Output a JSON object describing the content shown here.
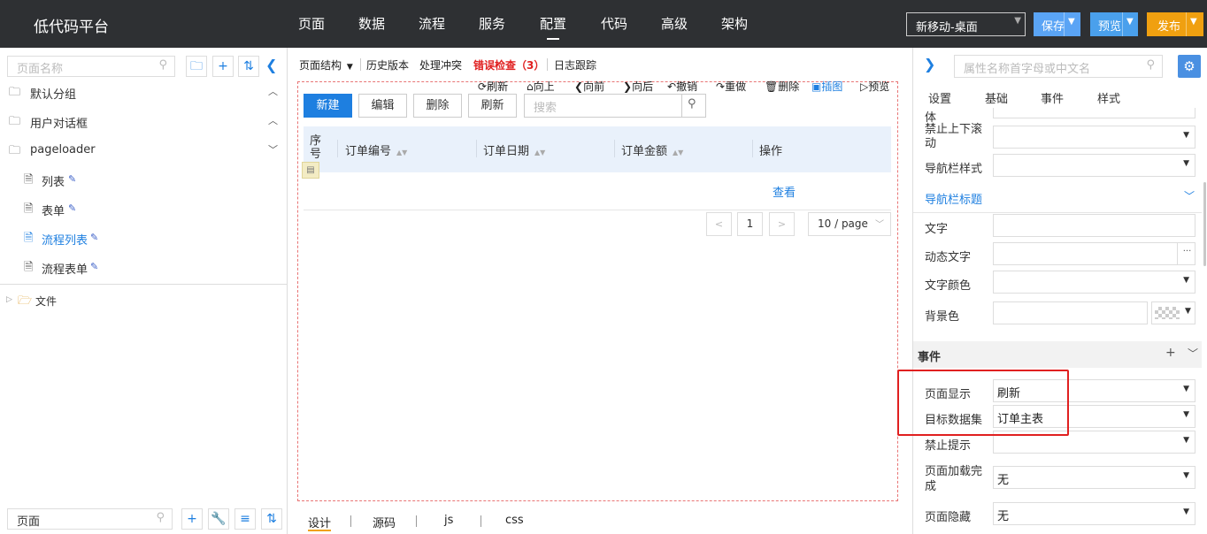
{
  "app": {
    "logo": "低代码平台",
    "nav": [
      "页面",
      "数据",
      "流程",
      "服务",
      "配置",
      "代码",
      "高级",
      "架构"
    ],
    "active_nav": "配置",
    "env_select": "新移动-桌面",
    "save_label": "保存",
    "preview_label": "预览",
    "publish_label": "发布",
    "colors": {
      "topbar": "#2e3033",
      "primary": "#1e7fe0",
      "save": "#5aa4f5",
      "preview": "#4aa0ec",
      "publish": "#f0a010",
      "error": "#e02020"
    }
  },
  "left": {
    "search_placeholder": "页面名称",
    "tree": [
      {
        "label": "默认分组",
        "icon": "folder-icon",
        "level": 0
      },
      {
        "label": "用户对话框",
        "icon": "folder-icon",
        "level": 0
      },
      {
        "label": "pageloader",
        "icon": "folder-icon",
        "level": 0
      },
      {
        "label": "列表",
        "icon": "page-icon",
        "level": 1
      },
      {
        "label": "表单",
        "icon": "page-icon",
        "level": 1
      },
      {
        "label": "流程列表",
        "icon": "page-icon",
        "level": 1,
        "selected": true
      },
      {
        "label": "流程表单",
        "icon": "page-icon",
        "level": 1
      }
    ],
    "files_label": "文件",
    "bottom_search_value": "页面"
  },
  "center": {
    "toolbar": {
      "structure": "页面结构",
      "history": "历史版本",
      "conflict": "处理冲突",
      "error_check": "错误检查（3）",
      "log": "日志跟踪"
    },
    "design_toolbar": [
      "刷新",
      "向上",
      "向前",
      "向后",
      "撤销",
      "重做",
      "删除",
      "插图",
      "预览"
    ],
    "buttons": {
      "new": "新建",
      "edit": "编辑",
      "delete": "删除",
      "refresh": "刷新"
    },
    "search_placeholder": "搜索",
    "columns": [
      "序号",
      "订单编号",
      "订单日期",
      "订单金额",
      "操作"
    ],
    "row_action": "查看",
    "pagination": {
      "page": "1",
      "size": "10 / page"
    },
    "bottom_tabs": [
      "设计",
      "源码",
      "js",
      "css"
    ],
    "active_bottom_tab": "设计"
  },
  "right": {
    "search_placeholder": "属性名称首字母或中文名",
    "tabs": [
      "设置",
      "基础",
      "事件",
      "样式"
    ],
    "top_fields": [
      {
        "label": "体",
        "value": ""
      },
      {
        "label": "禁止上下滚动",
        "value": ""
      },
      {
        "label": "导航栏样式",
        "value": ""
      }
    ],
    "nav_title_section": "导航栏标题",
    "nav_fields": [
      {
        "label": "文字",
        "value": ""
      },
      {
        "label": "动态文字",
        "value": ""
      },
      {
        "label": "文字颜色",
        "value": ""
      },
      {
        "label": "背景色",
        "value": ""
      }
    ],
    "events_section": "事件",
    "event_fields": [
      {
        "label": "页面显示",
        "value": "刷新"
      },
      {
        "label": "目标数据集",
        "value": "订单主表"
      },
      {
        "label": "禁止提示",
        "value": ""
      },
      {
        "label": "页面加载完成",
        "value": "无"
      },
      {
        "label": "页面隐藏",
        "value": "无"
      }
    ]
  }
}
